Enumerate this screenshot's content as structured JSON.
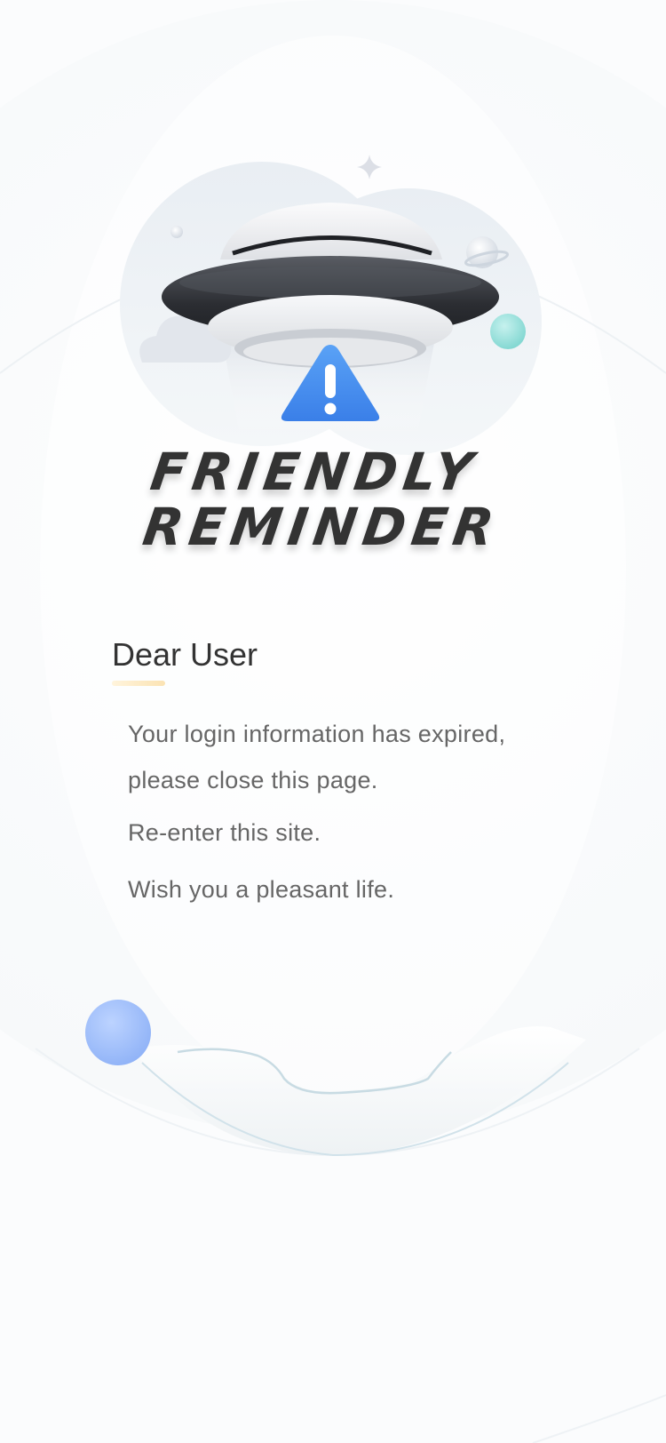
{
  "header": {
    "title_line1": "FRIENDLY",
    "title_line2": "REMINDER"
  },
  "message": {
    "greeting": "Dear User",
    "line1": "Your login information has expired,",
    "line2": "please close this page.",
    "line3": "Re-enter this site.",
    "line4": "Wish you a pleasant life."
  },
  "colors": {
    "title": "#333333",
    "greeting": "#333333",
    "body_text": "#666666",
    "warning": "#4a8ff0",
    "accent_underline": "#fbe3b3"
  },
  "icons": [
    "ufo-illustration",
    "warning-icon",
    "cloud-icon",
    "planet-icon",
    "sparkle-icon",
    "bubble-icon"
  ]
}
